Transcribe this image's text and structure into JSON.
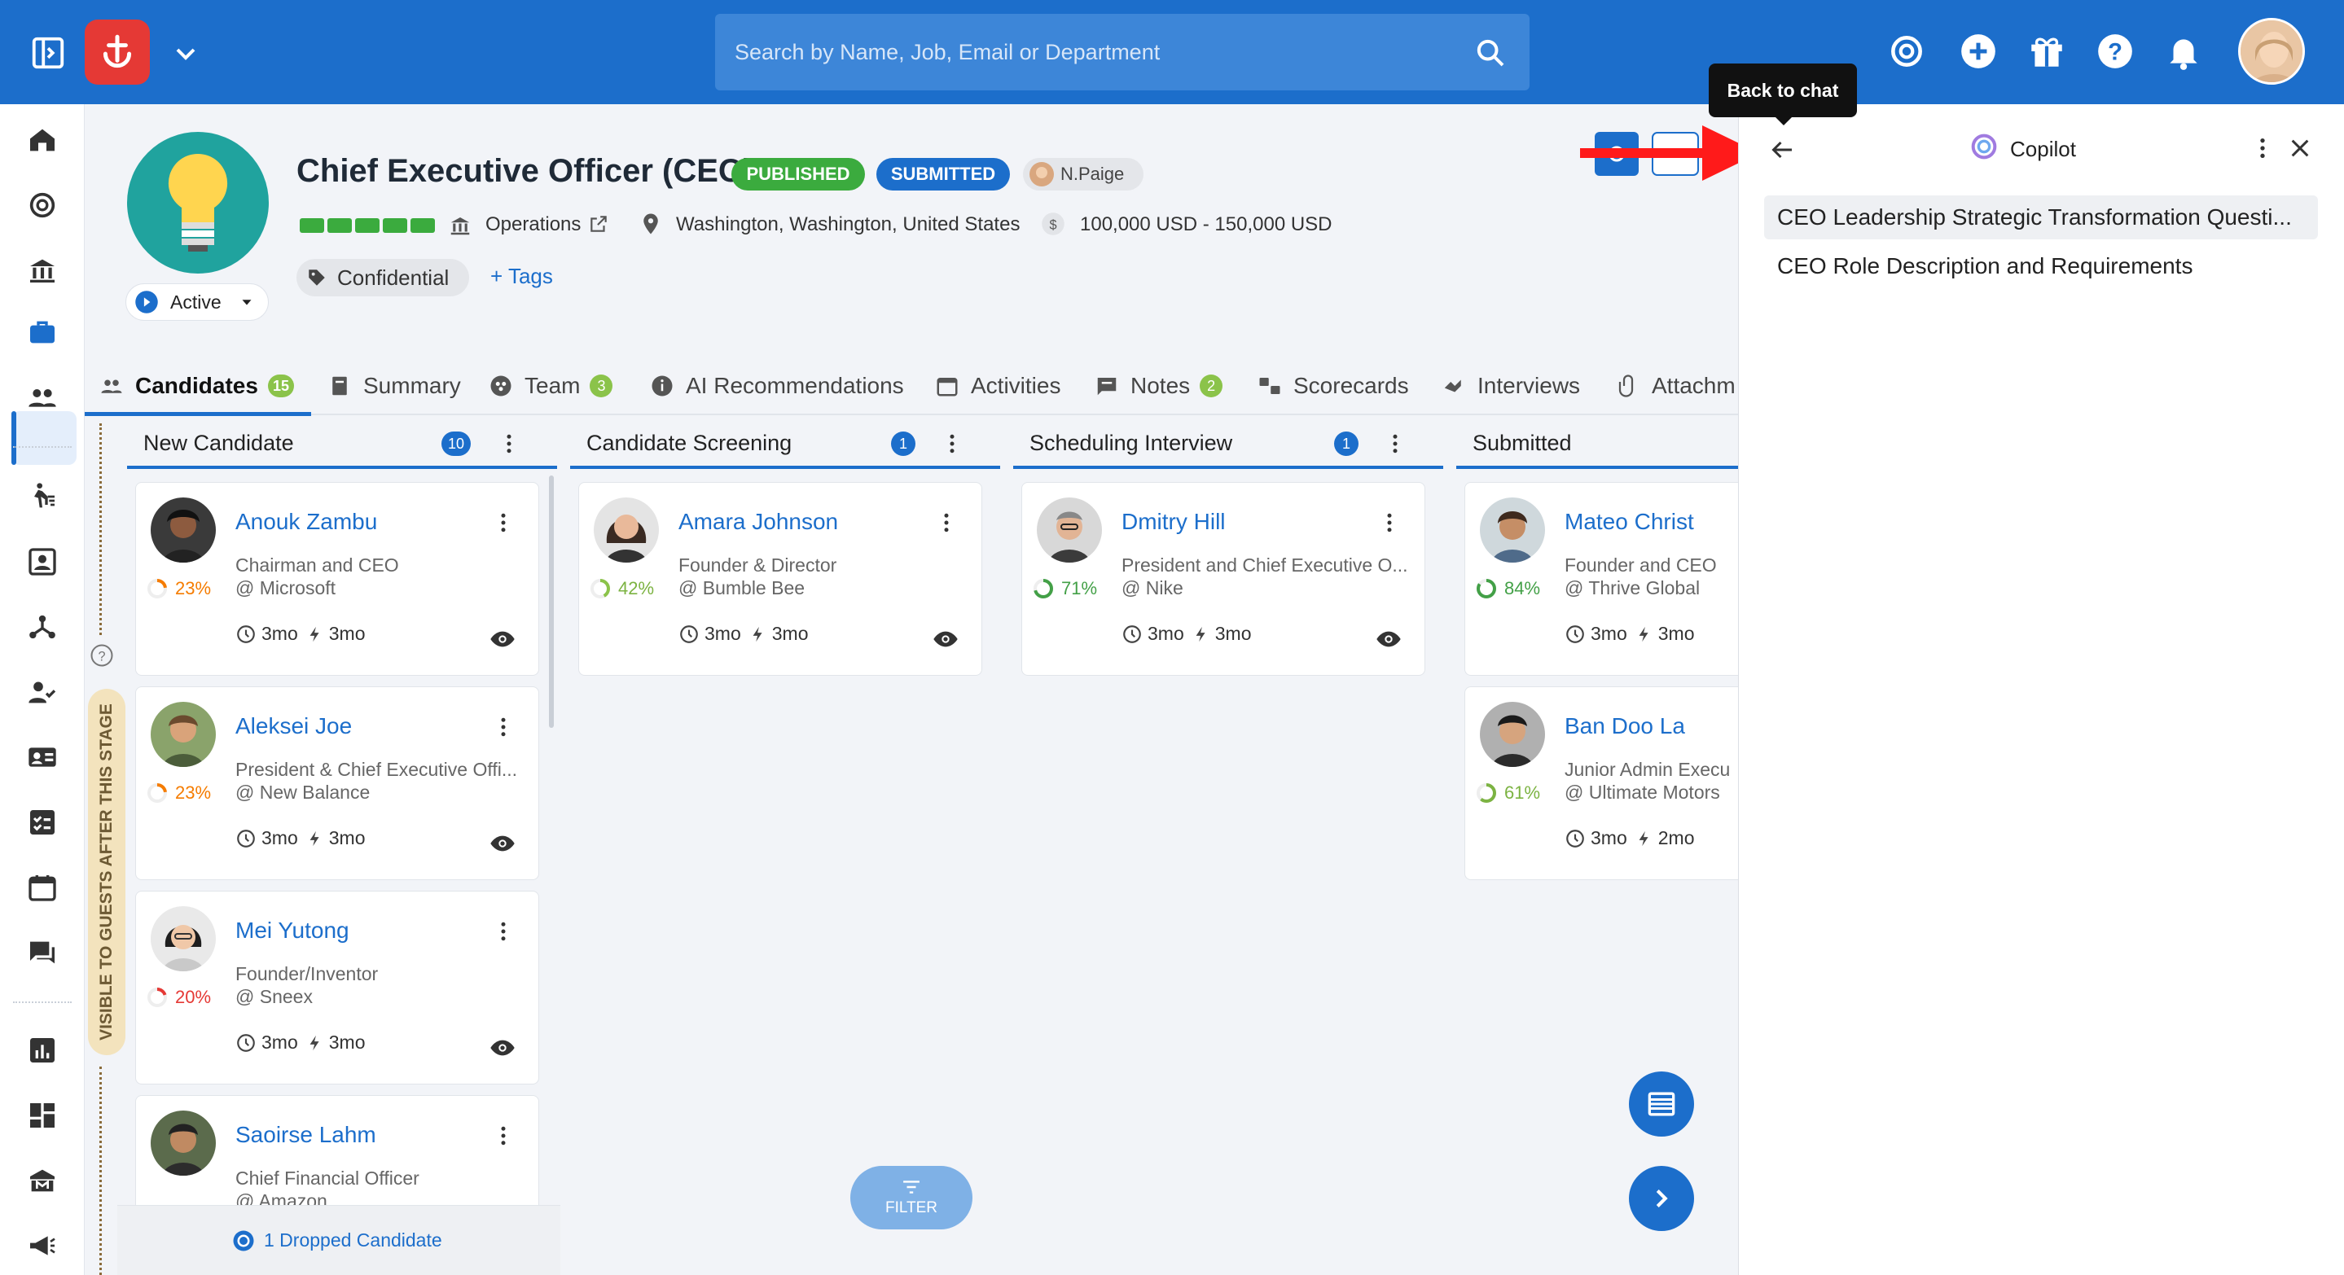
{
  "search": {
    "placeholder": "Search by Name, Job, Email or Department"
  },
  "job": {
    "title": "Chief Executive Officer (CEO)",
    "badges": {
      "published": "PUBLISHED",
      "submitted": "SUBMITTED"
    },
    "owner": "N.Paige",
    "status": "Active",
    "department": "Operations",
    "location": "Washington, Washington, United States",
    "salary": "100,000 USD - 150,000 USD",
    "tag": "Confidential",
    "add_tags": "+ Tags",
    "colors": {
      "published": "#3bab3e",
      "submitted": "#1c6ecb",
      "avatar_bg": "#20a39e"
    }
  },
  "tabs": [
    {
      "label": "Candidates",
      "count": "15"
    },
    {
      "label": "Summary"
    },
    {
      "label": "Team",
      "count": "3"
    },
    {
      "label": "AI Recommendations"
    },
    {
      "label": "Activities"
    },
    {
      "label": "Notes",
      "count": "2"
    },
    {
      "label": "Scorecards"
    },
    {
      "label": "Interviews"
    },
    {
      "label": "Attachm"
    }
  ],
  "stage_label": "VISIBLE TO GUESTS AFTER THIS STAGE",
  "columns": [
    {
      "title": "New Candidate",
      "count": "10"
    },
    {
      "title": "Candidate Screening",
      "count": "1"
    },
    {
      "title": "Scheduling Interview",
      "count": "1"
    },
    {
      "title": "Submitted"
    }
  ],
  "cards": {
    "c1": {
      "name": "Anouk Zambu",
      "role": "Chairman and CEO",
      "company": "@ Microsoft",
      "score": "23%",
      "score_value": 23,
      "t1": "3mo",
      "t2": "3mo"
    },
    "c2": {
      "name": "Aleksei Joe",
      "role": "President & Chief Executive Offi...",
      "company": "@ New Balance",
      "score": "23%",
      "score_value": 23,
      "t1": "3mo",
      "t2": "3mo"
    },
    "c3": {
      "name": "Mei Yutong",
      "role": "Founder/Inventor",
      "company": "@ Sneex",
      "score": "20%",
      "score_value": 20,
      "t1": "3mo",
      "t2": "3mo"
    },
    "c4": {
      "name": "Saoirse Lahm",
      "role": "Chief Financial Officer",
      "company": "@ Amazon"
    },
    "c5": {
      "name": "Amara Johnson",
      "role": "Founder & Director",
      "company": "@ Bumble Bee",
      "score": "42%",
      "score_value": 42,
      "t1": "3mo",
      "t2": "3mo"
    },
    "c6": {
      "name": "Dmitry Hill",
      "role": "President and Chief Executive O...",
      "company": "@ Nike",
      "score": "71%",
      "score_value": 71,
      "t1": "3mo",
      "t2": "3mo"
    },
    "c7": {
      "name": "Mateo Christ",
      "role": "Founder and CEO",
      "company": "@ Thrive Global",
      "score": "84%",
      "score_value": 84,
      "t1": "3mo",
      "t2": "3mo"
    },
    "c8": {
      "name": "Ban Doo La",
      "role": "Junior Admin Execu",
      "company": "@ Ultimate Motors",
      "score": "61%",
      "score_value": 61,
      "t1": "3mo",
      "t2": "2mo"
    }
  },
  "dropped": "1 Dropped Candidate",
  "filter": "FILTER",
  "copilot": {
    "title": "Copilot",
    "tooltip": "Back to chat",
    "items": [
      "CEO Leadership Strategic Transformation Questi...",
      "CEO Role Description and Requirements"
    ]
  },
  "icons": [
    "sidebar-toggle-icon",
    "chevron-down-icon",
    "search-icon",
    "openai-icon",
    "plus-circle-icon",
    "gift-icon",
    "help-icon",
    "bell-icon",
    "home-icon",
    "bank-icon",
    "briefcase-icon",
    "people-icon",
    "clock-icon",
    "lightning-icon",
    "eye-icon",
    "kebab-icon",
    "back-arrow-icon",
    "close-icon"
  ]
}
